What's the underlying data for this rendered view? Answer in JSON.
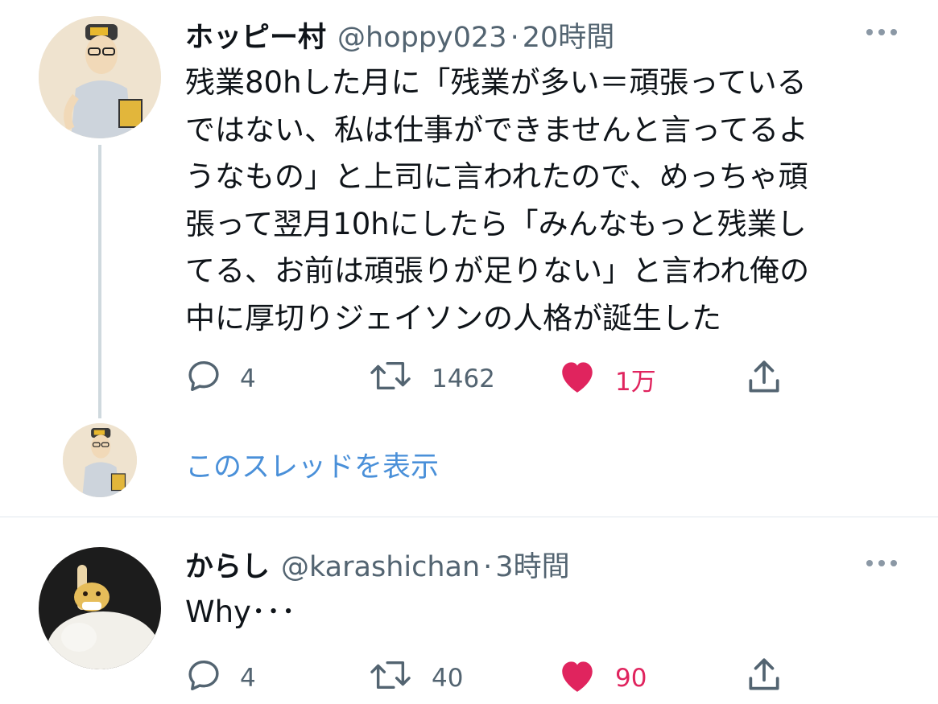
{
  "tweets": [
    {
      "display_name": "ホッピー村",
      "handle": "@hoppy023",
      "separator": "·",
      "time": "20時間",
      "text": "残業80hした月に「残業が多い＝頑張っている\nではない、私は仕事ができませんと言ってるよ\nうなもの」と上司に言われたので、めっちゃ頑\n張って翌月10hにしたら「みんなもっと残業し\nてる、お前は頑張りが足りない」と言われ俺の\n中に厚切りジェイソンの人格が誕生した",
      "reply_count": "4",
      "retweet_count": "1462",
      "like_count": "1万",
      "liked": true
    },
    {
      "display_name": "からし",
      "handle": "@karashichan",
      "separator": "·",
      "time": "3時間",
      "text": "Why･･･",
      "reply_count": "4",
      "retweet_count": "40",
      "like_count": "90",
      "liked": true
    }
  ],
  "show_thread_label": "このスレッドを表示",
  "icons": {
    "more": "more-icon",
    "reply": "reply-icon",
    "retweet": "retweet-icon",
    "like": "heart-icon",
    "share": "share-icon"
  },
  "colors": {
    "link": "#4a90d9",
    "like": "#e0245e",
    "muted": "#536471"
  }
}
